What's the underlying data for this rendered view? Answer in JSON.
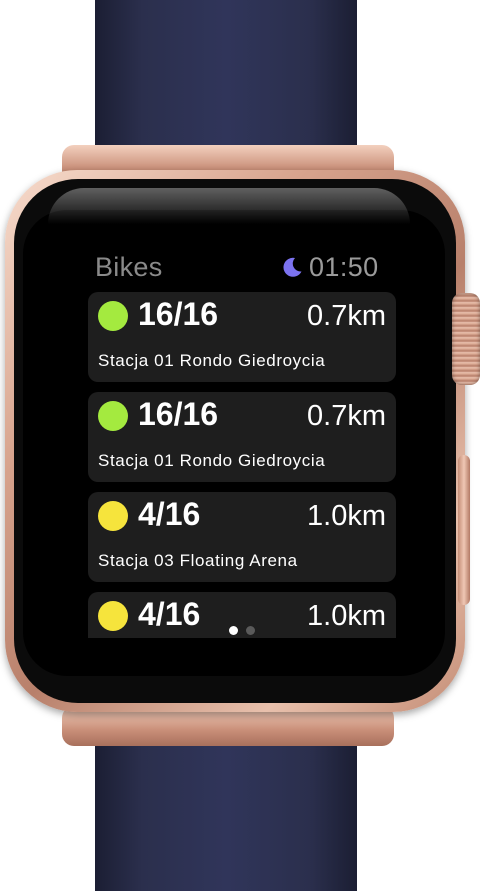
{
  "app": {
    "title": "Bikes",
    "time": "01:50",
    "status_icon": "moon-icon",
    "moon_color": "#7c73f0"
  },
  "stations": [
    {
      "available": "16/16",
      "distance": "0.7km",
      "name": "Stacja 01 Rondo Giedroycia",
      "status_color": "#a4ea3f"
    },
    {
      "available": "16/16",
      "distance": "0.7km",
      "name": "Stacja 01 Rondo Giedroycia",
      "status_color": "#a4ea3f"
    },
    {
      "available": "4/16",
      "distance": "1.0km",
      "name": "Stacja 03 Floating Arena",
      "status_color": "#f6e43c"
    },
    {
      "available": "4/16",
      "distance": "1.0km",
      "name": "",
      "status_color": "#f6e43c"
    }
  ],
  "pagination": {
    "page_count": 2,
    "current_page": 1,
    "active_color": "#ffffff",
    "inactive_color": "#5a5a5a"
  },
  "colors": {
    "card_background": "#1e1e1e",
    "title_text": "#8a8a8a",
    "primary_text": "#ffffff",
    "band": "#2b2f4d",
    "case": "#d7a38d"
  }
}
